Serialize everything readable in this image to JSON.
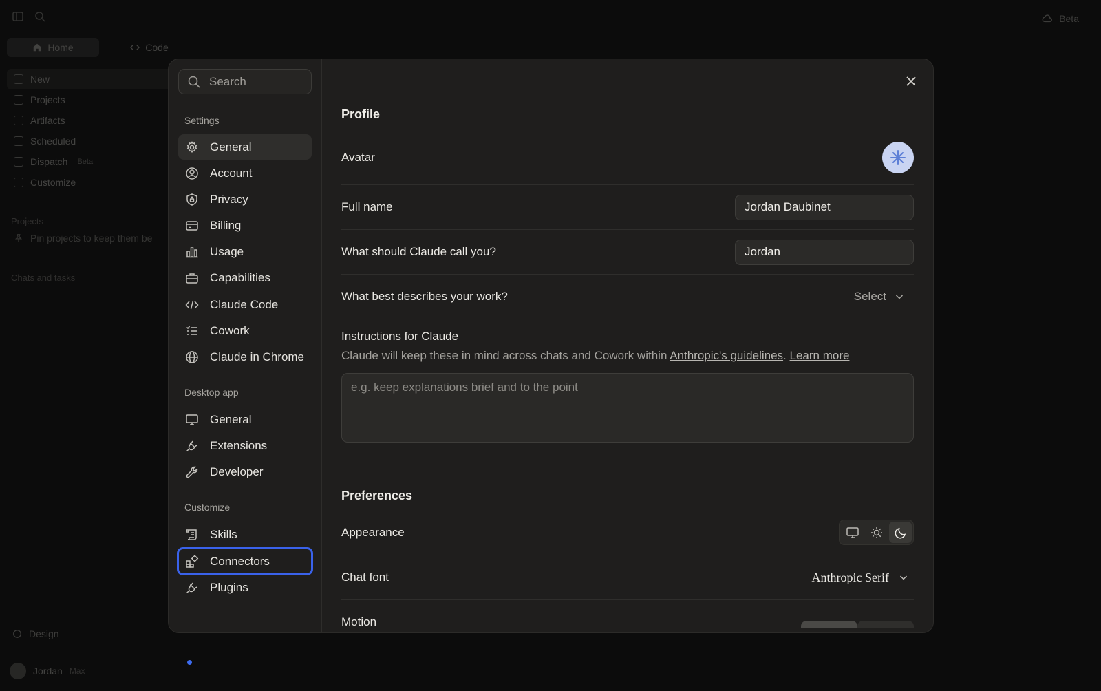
{
  "background": {
    "beta_label": "Beta",
    "tabs": [
      {
        "label": "Home"
      },
      {
        "label": "Code"
      }
    ],
    "nav": [
      {
        "label": "New"
      },
      {
        "label": "Projects"
      },
      {
        "label": "Artifacts"
      },
      {
        "label": "Scheduled"
      },
      {
        "label": "Dispatch",
        "badge": "Beta"
      },
      {
        "label": "Customize"
      }
    ],
    "projects_heading": "Projects",
    "projects_hint": "Pin projects to keep them be",
    "chats_heading": "Chats and tasks",
    "design_label": "Design",
    "user": {
      "name": "Jordan",
      "plan": "Max"
    }
  },
  "search": {
    "placeholder": "Search"
  },
  "sidebar": {
    "settings_heading": "Settings",
    "settings_items": [
      {
        "label": "General",
        "icon": "gear-icon"
      },
      {
        "label": "Account",
        "icon": "user-circle-icon"
      },
      {
        "label": "Privacy",
        "icon": "shield-lock-icon"
      },
      {
        "label": "Billing",
        "icon": "credit-card-icon"
      },
      {
        "label": "Usage",
        "icon": "bar-chart-icon"
      },
      {
        "label": "Capabilities",
        "icon": "briefcase-icon"
      },
      {
        "label": "Claude Code",
        "icon": "code-icon"
      },
      {
        "label": "Cowork",
        "icon": "checklist-icon"
      },
      {
        "label": "Claude in Chrome",
        "icon": "globe-icon"
      }
    ],
    "desktop_heading": "Desktop app",
    "desktop_items": [
      {
        "label": "General",
        "icon": "monitor-icon"
      },
      {
        "label": "Extensions",
        "icon": "plug-icon"
      },
      {
        "label": "Developer",
        "icon": "wrench-icon"
      }
    ],
    "customize_heading": "Customize",
    "customize_items": [
      {
        "label": "Skills",
        "icon": "scroll-icon"
      },
      {
        "label": "Connectors",
        "icon": "connectors-icon"
      },
      {
        "label": "Plugins",
        "icon": "plug-icon"
      }
    ]
  },
  "profile": {
    "heading": "Profile",
    "avatar_label": "Avatar",
    "full_name_label": "Full name",
    "full_name_value": "Jordan Daubinet",
    "nickname_label": "What should Claude call you?",
    "nickname_value": "Jordan",
    "work_label": "What best describes your work?",
    "work_value": "Select",
    "instructions_label": "Instructions for Claude",
    "instructions_desc": "Claude will keep these in mind across chats and Cowork within ",
    "guidelines_link": "Anthropic's guidelines",
    "desc_period": ".",
    "learn_more": "Learn more",
    "instructions_placeholder": "e.g. keep explanations brief and to the point"
  },
  "preferences": {
    "heading": "Preferences",
    "appearance_label": "Appearance",
    "appearance_selected": "dark",
    "chat_font_label": "Chat font",
    "chat_font_value": "Anthropic Serif",
    "motion_label": "Motion"
  },
  "colors": {
    "focus_ring": "#3a62ea",
    "modal_bg": "#1f1e1d",
    "avatar_bg": "#c9d4f2",
    "avatar_glyph": "#5d7fd6"
  }
}
